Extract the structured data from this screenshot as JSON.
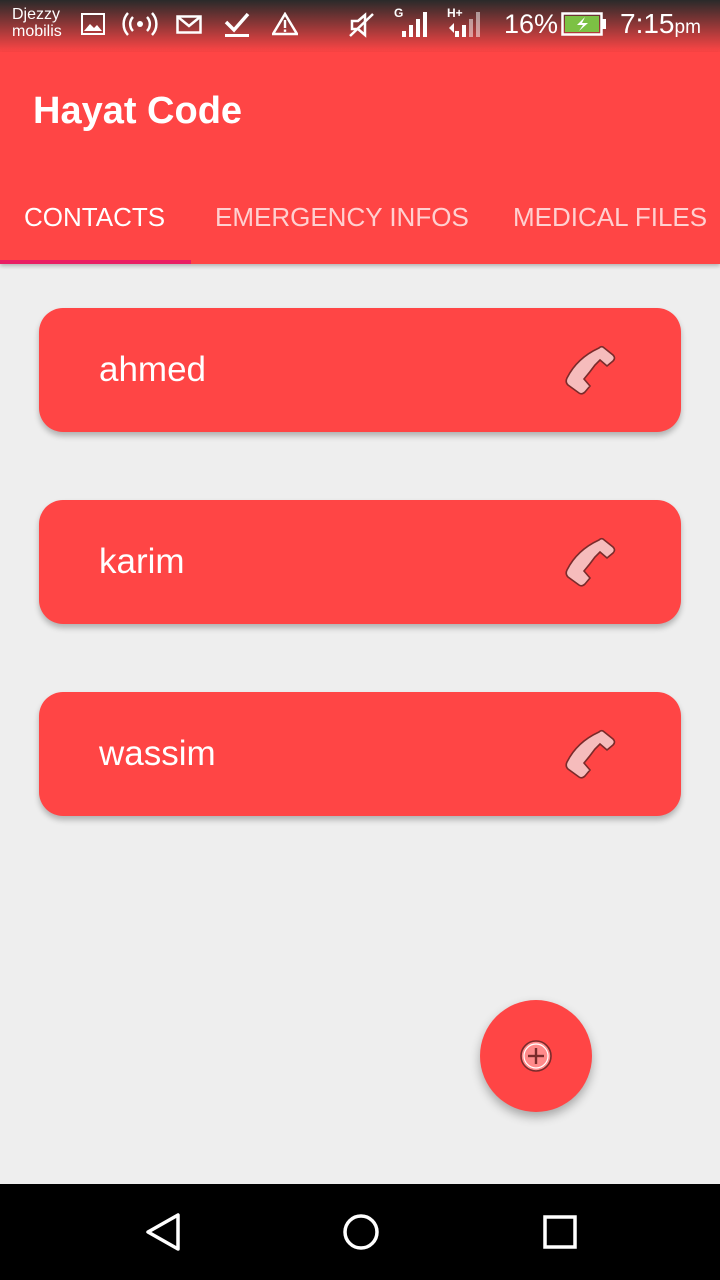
{
  "status_bar": {
    "carrier_line1": "Djezzy",
    "carrier_line2": "mobilis",
    "network_labels": [
      "G",
      "H+"
    ],
    "battery_percent": "16%",
    "time": "7:15",
    "time_suffix": "pm",
    "icons": [
      "image-icon",
      "hotspot-icon",
      "mail-icon",
      "download-done-icon",
      "warning-icon",
      "mute-icon",
      "signal-g-icon",
      "signal-hplus-icon",
      "battery-icon"
    ]
  },
  "app": {
    "title": "Hayat Code",
    "accent_color": "#ff4545",
    "tab_indicator_color": "#e91e63"
  },
  "tabs": [
    {
      "label": "CONTACTS",
      "active": true
    },
    {
      "label": "EMERGENCY INFOS",
      "active": false
    },
    {
      "label": "MEDICAL FILES",
      "active": false
    }
  ],
  "contacts": [
    {
      "name": "ahmed",
      "icon": "phone-icon"
    },
    {
      "name": "karim",
      "icon": "phone-icon"
    },
    {
      "name": "wassim",
      "icon": "phone-icon"
    }
  ],
  "fab": {
    "icon": "add-circle-icon"
  },
  "nav_bar": {
    "buttons": [
      "back-icon",
      "home-icon",
      "recents-icon"
    ]
  }
}
